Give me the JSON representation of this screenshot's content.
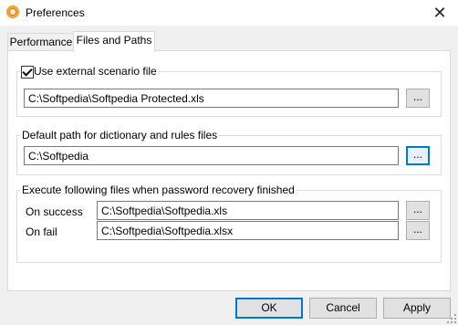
{
  "window": {
    "title": "Preferences",
    "close_glyph": "✕"
  },
  "tabs": [
    {
      "label": "Performance"
    },
    {
      "label": "Files and Paths"
    }
  ],
  "scenario": {
    "checkbox_label": "Use external scenario file",
    "checked": true,
    "path": "C:\\Softpedia\\Softpedia Protected.xls",
    "browse_label": "..."
  },
  "dictionary": {
    "group_label": "Default path for dictionary and rules files",
    "path": "C:\\Softpedia",
    "browse_label": "..."
  },
  "execute": {
    "group_label": "Execute following files when password recovery finished",
    "success_label": "On success",
    "success_path": "C:\\Softpedia\\Softpedia.xls",
    "fail_label": "On fail",
    "fail_path": "C:\\Softpedia\\Softpedia.xlsx",
    "browse_label": "..."
  },
  "buttons": {
    "ok": "OK",
    "cancel": "Cancel",
    "apply": "Apply"
  },
  "colors": {
    "accent": "#0078d7",
    "icon": "#e07b17"
  }
}
